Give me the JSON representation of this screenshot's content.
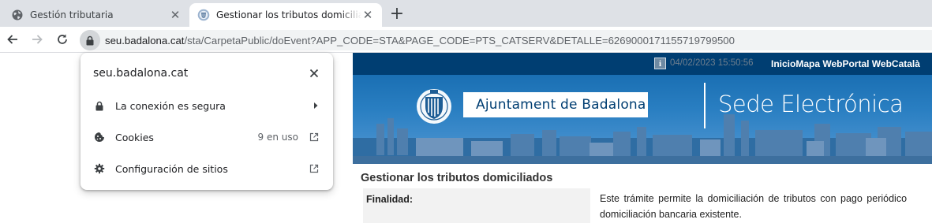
{
  "browser": {
    "tabs": [
      {
        "label": "Gestión tributaria",
        "active": false,
        "icon": "globe-icon"
      },
      {
        "label": "Gestionar los tributos domiciliados",
        "active": true,
        "icon": "badalona-seal-icon"
      }
    ],
    "close_glyph": "✕",
    "new_tab_glyph": "+",
    "url_host": "seu.badalona.cat",
    "url_path": "/sta/CarpetaPublic/doEvent?APP_CODE=STA&PAGE_CODE=PTS_CATSERV&DETALLE=6269000171155719799500"
  },
  "site_info_popup": {
    "title": "seu.badalona.cat",
    "items": [
      {
        "icon": "lock-icon",
        "label": "La conexión es segura",
        "trailing": "chevron-right-icon"
      },
      {
        "icon": "cookie-icon",
        "label": "Cookies",
        "count": "9 en uso",
        "trailing": "open-external-icon"
      },
      {
        "icon": "gear-icon",
        "label": "Configuración de sitios",
        "trailing": "open-external-icon"
      }
    ]
  },
  "page": {
    "topbar": {
      "info_glyph": "i",
      "datetime": "04/02/2023 15:50:56",
      "links": "InicioMapa WebPortal WebCatalà"
    },
    "banner": {
      "org_name": "Ajuntament de Badalona",
      "portal_name": "Sede Electrónica"
    },
    "title": "Gestionar los tributos domiciliados",
    "rows": [
      {
        "label": "Finalidad:",
        "value_line1": "Este trámite permite la domiciliación de tributos con pago periódico",
        "value_line2": "domiciliación bancaria existente."
      }
    ]
  },
  "colors": {
    "tabstrip": "#dee1e6",
    "site_header": "#003e72",
    "banner_blue": "#2a7fc2"
  }
}
